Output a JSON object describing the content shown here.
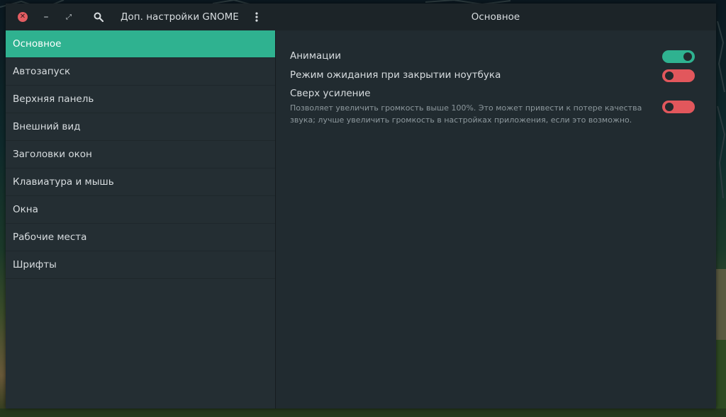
{
  "window": {
    "app_title": "Доп. настройки GNOME",
    "page_title": "Основное"
  },
  "titlebar": {
    "close_icon": "close-icon",
    "minimize_icon": "minimize-icon",
    "maximize_icon": "maximize-icon",
    "search_icon": "search-icon",
    "menu_icon": "vertical-dots-icon"
  },
  "sidebar": {
    "items": [
      {
        "label": "Основное",
        "active": true
      },
      {
        "label": "Автозапуск",
        "active": false
      },
      {
        "label": "Верхняя панель",
        "active": false
      },
      {
        "label": "Внешний вид",
        "active": false
      },
      {
        "label": "Заголовки окон",
        "active": false
      },
      {
        "label": "Клавиатура и мышь",
        "active": false
      },
      {
        "label": "Окна",
        "active": false
      },
      {
        "label": "Рабочие места",
        "active": false
      },
      {
        "label": "Шрифты",
        "active": false
      }
    ]
  },
  "settings": {
    "animations": {
      "label": "Анимации",
      "enabled": true
    },
    "suspend_on_lid_close": {
      "label": "Режим ожидания при закрытии ноутбука",
      "enabled": false
    },
    "over_amplification": {
      "label": "Сверх усиление",
      "description": "Позволяет увеличить громкость выше 100%. Это может привести к потере качества звука; лучше увеличить громкость в настройках приложения, если это возможно.",
      "enabled": false
    }
  },
  "colors": {
    "accent": "#2fb290",
    "toggle_off": "#e2575c",
    "close_button": "#e35d62",
    "window_bg": "#212b30",
    "sidebar_bg": "#242e33"
  }
}
